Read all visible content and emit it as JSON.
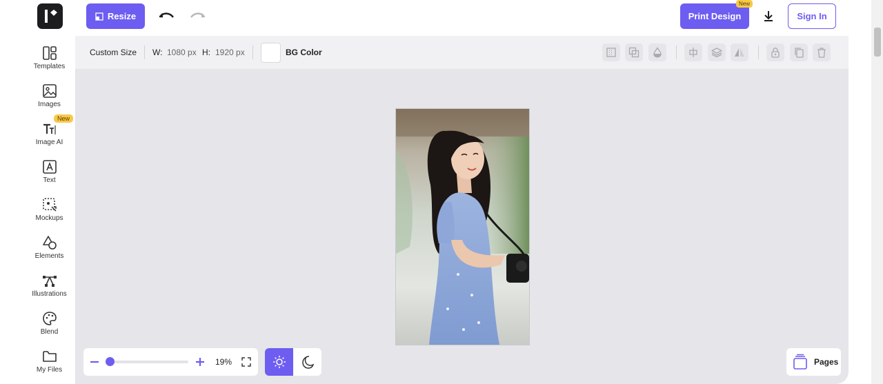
{
  "header": {
    "resize_label": "Resize",
    "print_label": "Print Design",
    "new_badge": "New",
    "signin_label": "Sign In"
  },
  "sidebar": {
    "items": [
      {
        "label": "Templates",
        "icon": "templates-icon"
      },
      {
        "label": "Images",
        "icon": "image-icon"
      },
      {
        "label": "Image AI",
        "icon": "image-ai-icon",
        "badge": "New"
      },
      {
        "label": "Text",
        "icon": "text-icon"
      },
      {
        "label": "Mockups",
        "icon": "mockups-icon"
      },
      {
        "label": "Elements",
        "icon": "elements-icon"
      },
      {
        "label": "Illustrations",
        "icon": "illustrations-icon"
      },
      {
        "label": "Blend",
        "icon": "palette-icon"
      },
      {
        "label": "My Files",
        "icon": "folder-icon"
      }
    ]
  },
  "props": {
    "size_label": "Custom Size",
    "w_label": "W:",
    "w_value": "1080 px",
    "h_label": "H:",
    "h_value": "1920 px",
    "bg_label": "BG Color"
  },
  "canvas": {
    "zoom_value": "19%",
    "zoom_level": 0.19,
    "pages_label": "Pages"
  },
  "colors": {
    "accent": "#6d5df0",
    "badge": "#f7c948",
    "canvas_bg": "#e5e5ea"
  }
}
